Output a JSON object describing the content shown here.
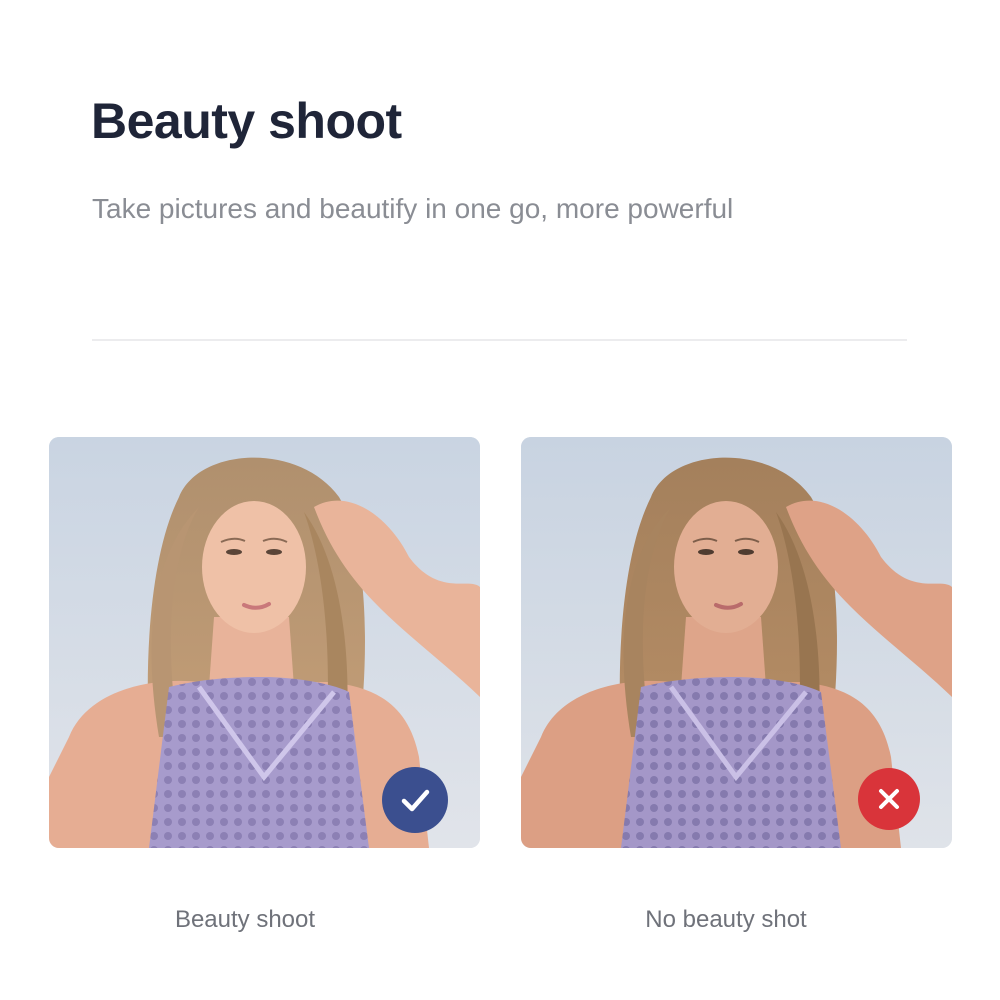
{
  "header": {
    "title": "Beauty shoot",
    "subtitle": "Take pictures and beautify in one go, more powerful"
  },
  "comparison": [
    {
      "caption": "Beauty shoot",
      "badge_icon": "check-icon",
      "badge_color": "#3b4f8f",
      "beautified": true
    },
    {
      "caption": "No beauty shot",
      "badge_icon": "cross-icon",
      "badge_color": "#d9343a",
      "beautified": false
    }
  ],
  "colors": {
    "title": "#1f2538",
    "subtitle": "#8a8d94",
    "caption": "#6f727a",
    "divider": "#ececee"
  }
}
